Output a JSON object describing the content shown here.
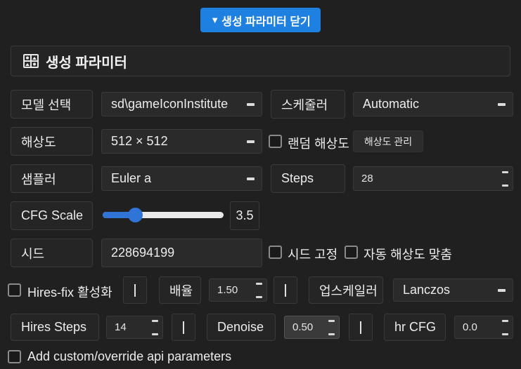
{
  "toggle": {
    "arrow": "▼",
    "label": "생성 파라미터 닫기"
  },
  "header": {
    "title": "생성 파라미터",
    "logo_icon": "mosaic-logo-icon"
  },
  "model": {
    "label": "모델 선택",
    "value": "sd\\gameIconInstitute"
  },
  "scheduler": {
    "label": "스케줄러",
    "value": "Automatic"
  },
  "resolution": {
    "label": "해상도",
    "value": "512 × 512"
  },
  "random_resolution": {
    "label": "랜덤 해상도",
    "checked": false
  },
  "manage_resolution": {
    "label": "해상도 관리"
  },
  "sampler": {
    "label": "샘플러",
    "value": "Euler a"
  },
  "steps": {
    "label": "Steps",
    "value": "28"
  },
  "cfg": {
    "label": "CFG Scale",
    "value": "3.5",
    "slider_fraction": 0.27
  },
  "seed": {
    "label": "시드",
    "value": "228694199"
  },
  "seed_fixed": {
    "label": "시드 고정",
    "checked": false
  },
  "auto_resolution": {
    "label": "자동 해상도 맞춤",
    "checked": false
  },
  "hires": {
    "label": "Hires-fix 활성화",
    "checked": false
  },
  "scale": {
    "label": "배율",
    "value": "1.50"
  },
  "upscaler": {
    "label": "업스케일러",
    "value": "Lanczos"
  },
  "hires_steps": {
    "label": "Hires Steps",
    "value": "14"
  },
  "denoise": {
    "label": "Denoise",
    "value": "0.50"
  },
  "hr_cfg": {
    "label": "hr CFG",
    "value": "0.0"
  },
  "custom_params": {
    "label": "Add custom/override api parameters",
    "checked": false
  }
}
